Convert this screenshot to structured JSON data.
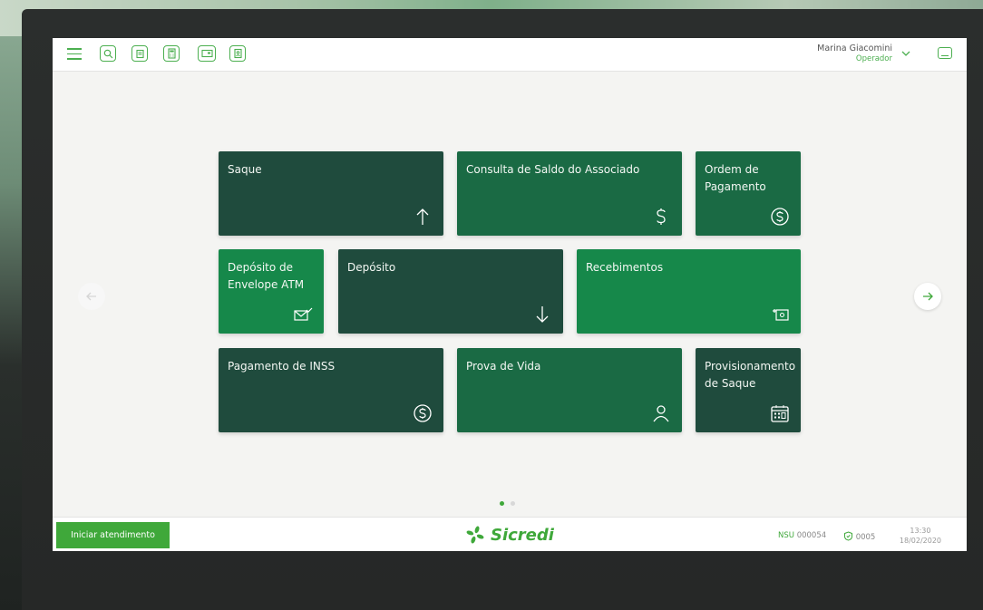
{
  "header": {
    "user_name": "Marina Giacomini",
    "user_role": "Operador",
    "toolbar_icons": [
      "menu-icon",
      "search-icon",
      "receipt-icon",
      "calculator-icon",
      "card-icon",
      "badge-icon"
    ]
  },
  "tiles": [
    {
      "label": "Saque",
      "icon": "arrow-up-icon",
      "color": "#1f4b3d"
    },
    {
      "label": "Consulta de Saldo do Associado",
      "icon": "dollar-icon",
      "color": "#1a6a44"
    },
    {
      "label": "Ordem de Pagamento",
      "icon": "coin-icon",
      "color": "#1a6a44"
    },
    {
      "label": "Depósito de Envelope ATM",
      "icon": "envelope-check-icon",
      "color": "#16884a"
    },
    {
      "label": "Depósito",
      "icon": "arrow-down-icon",
      "color": "#1f4b3d"
    },
    {
      "label": "Recebimentos",
      "icon": "cash-plus-icon",
      "color": "#16884a"
    },
    {
      "label": "Pagamento de INSS",
      "icon": "coin-icon",
      "color": "#1f4b3d"
    },
    {
      "label": "Prova de Vida",
      "icon": "person-icon",
      "color": "#1a6a44"
    },
    {
      "label": "Provisionamento de Saque",
      "icon": "calendar-icon",
      "color": "#1f4b3d"
    }
  ],
  "pagination": {
    "current": 1,
    "total": 2
  },
  "footer": {
    "start_label": "Iniciar atendimento",
    "brand": "Sicredi",
    "nsu_label": "NSU",
    "nsu_value": "000054",
    "agency": "0005",
    "time": "13:30",
    "date": "18/02/2020"
  },
  "colors": {
    "accent": "#3fa83a",
    "tile_dark": "#1f4b3d",
    "tile_mid": "#1a6a44",
    "tile_green": "#16884a"
  }
}
